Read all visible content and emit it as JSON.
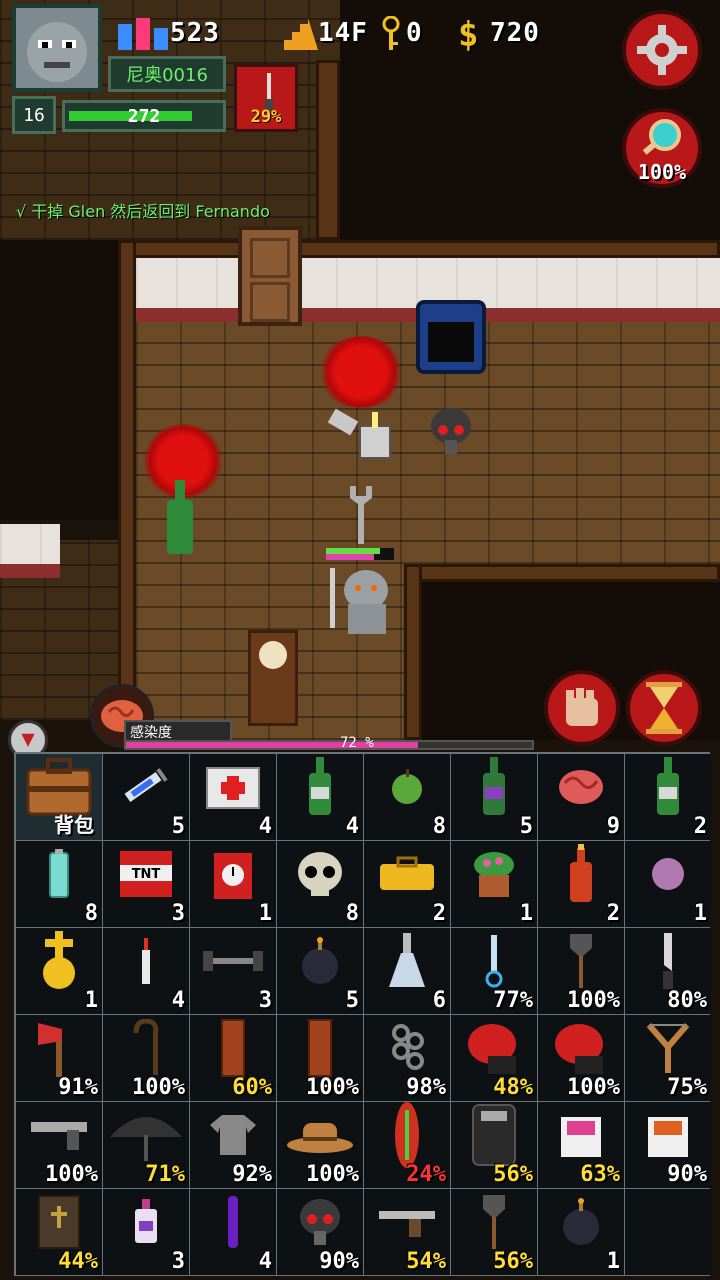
{
  "hud": {
    "squad_count": "523",
    "floor": "14F",
    "keys": "0",
    "money": "720",
    "player_name": "尼奥0016",
    "level": "16",
    "hp": "272",
    "hp_fraction": 0.82,
    "weapon_durability": "29%",
    "search_percent": "100%"
  },
  "quest": {
    "check": "√",
    "text": "干掉 Glen 然后返回到 Fernando"
  },
  "infection": {
    "label": "感染度",
    "value": "72 %",
    "fraction": 0.72
  },
  "inventory": {
    "bag_label": "背包",
    "cells": [
      {
        "icon": "syringe-icon",
        "count": "5",
        "color": "#ffffff"
      },
      {
        "icon": "medkit-icon",
        "count": "4",
        "color": "#ffffff"
      },
      {
        "icon": "green-bottle-icon",
        "count": "4",
        "color": "#ffffff"
      },
      {
        "icon": "green-apple-icon",
        "count": "8",
        "color": "#ffffff"
      },
      {
        "icon": "purple-bottle-icon",
        "count": "5",
        "color": "#ffffff"
      },
      {
        "icon": "brain-icon",
        "count": "9",
        "color": "#ffffff"
      },
      {
        "icon": "green-bottle-icon",
        "count": "2",
        "color": "#ffffff"
      },
      {
        "icon": "battery-icon",
        "count": "8",
        "color": "#ffffff"
      },
      {
        "icon": "tnt-icon",
        "count": "3",
        "color": "#ffffff"
      },
      {
        "icon": "time-bomb-icon",
        "count": "1",
        "color": "#ffffff"
      },
      {
        "icon": "skull-icon",
        "count": "8",
        "color": "#ffffff"
      },
      {
        "icon": "yellow-case-icon",
        "count": "2",
        "color": "#ffffff"
      },
      {
        "icon": "potted-plant-icon",
        "count": "1",
        "color": "#ffffff"
      },
      {
        "icon": "molotov-icon",
        "count": "2",
        "color": "#ffffff"
      },
      {
        "icon": "pink-orb-icon",
        "count": "1",
        "color": "#ffffff"
      },
      {
        "icon": "golden-cross-icon",
        "count": "1",
        "color": "#ffffff"
      },
      {
        "icon": "lighter-icon",
        "count": "4",
        "color": "#ffffff"
      },
      {
        "icon": "dumbbell-icon",
        "count": "3",
        "color": "#ffffff"
      },
      {
        "icon": "bomb-icon",
        "count": "5",
        "color": "#ffffff"
      },
      {
        "icon": "flask-icon",
        "count": "6",
        "color": "#ffffff"
      },
      {
        "icon": "blue-flashlight-icon",
        "count": "77%",
        "color": "#ffffff"
      },
      {
        "icon": "shovel-icon",
        "count": "100%",
        "color": "#ffffff"
      },
      {
        "icon": "knife-icon",
        "count": "80%",
        "color": "#ffffff"
      },
      {
        "icon": "fire-axe-icon",
        "count": "91%",
        "color": "#ffffff"
      },
      {
        "icon": "cane-icon",
        "count": "100%",
        "color": "#ffffff"
      },
      {
        "icon": "wood-plank-icon",
        "count": "60%",
        "color": "#ffdd33"
      },
      {
        "icon": "wood-plank-icon",
        "count": "100%",
        "color": "#ffffff"
      },
      {
        "icon": "brass-knuckles-icon",
        "count": "98%",
        "color": "#ffffff"
      },
      {
        "icon": "boxing-glove-icon",
        "count": "48%",
        "color": "#ffdd33"
      },
      {
        "icon": "boxing-glove-icon",
        "count": "100%",
        "color": "#ffffff"
      },
      {
        "icon": "slingshot-icon",
        "count": "75%",
        "color": "#ffffff"
      },
      {
        "icon": "pistol-icon",
        "count": "100%",
        "color": "#ffffff"
      },
      {
        "icon": "umbrella-icon",
        "count": "71%",
        "color": "#ffdd33"
      },
      {
        "icon": "shirt-icon",
        "count": "92%",
        "color": "#ffffff"
      },
      {
        "icon": "cowboy-hat-icon",
        "count": "100%",
        "color": "#ffffff"
      },
      {
        "icon": "surfboard-icon",
        "count": "24%",
        "color": "#ff3333"
      },
      {
        "icon": "riot-shield-icon",
        "count": "56%",
        "color": "#ffdd33"
      },
      {
        "icon": "pink-box-icon",
        "count": "63%",
        "color": "#ffdd33"
      },
      {
        "icon": "orange-box-icon",
        "count": "90%",
        "color": "#ffffff"
      },
      {
        "icon": "bible-icon",
        "count": "44%",
        "color": "#ffdd33"
      },
      {
        "icon": "small-potion-icon",
        "count": "3",
        "color": "#ffffff"
      },
      {
        "icon": "purple-vial-icon",
        "count": "4",
        "color": "#ffffff"
      },
      {
        "icon": "gas-mask-icon",
        "count": "90%",
        "color": "#ffffff"
      },
      {
        "icon": "revolver-icon",
        "count": "54%",
        "color": "#ffdd33"
      },
      {
        "icon": "shovel-icon",
        "count": "56%",
        "color": "#ffdd33"
      },
      {
        "icon": "bomb-icon",
        "count": "1",
        "color": "#ffffff"
      },
      {
        "icon": "",
        "count": "",
        "color": "#ffffff"
      }
    ]
  },
  "colors": {
    "hud_green": "#6cf06c",
    "accent_red": "#b81818",
    "gold": "#ffcc33"
  }
}
